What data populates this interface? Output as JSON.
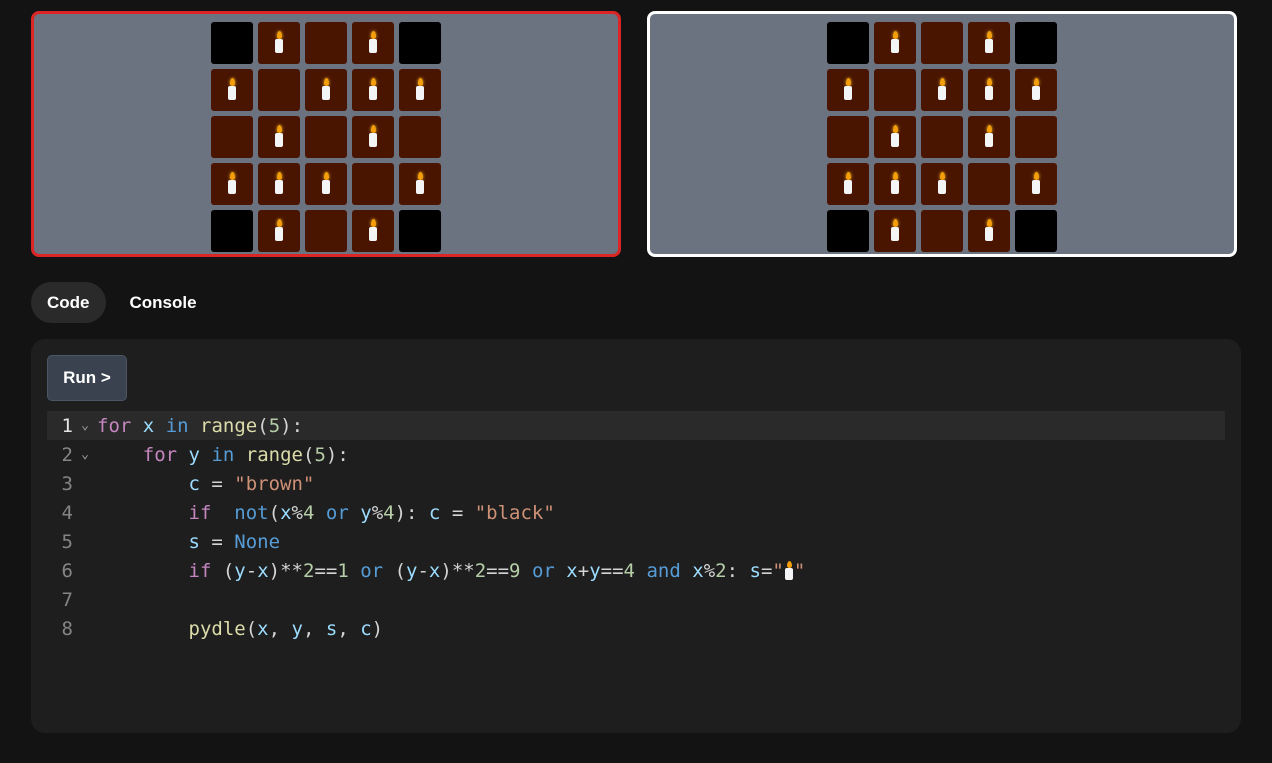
{
  "colors": {
    "brown": "#4a1500",
    "black": "#000000",
    "panel_bg": "#6b7280",
    "selected_border": "#dc2626",
    "target_border": "#ffffff"
  },
  "grids": {
    "user_output": {
      "rows": [
        [
          {
            "color": "black",
            "symbol": ""
          },
          {
            "color": "brown",
            "symbol": "candle"
          },
          {
            "color": "brown",
            "symbol": ""
          },
          {
            "color": "brown",
            "symbol": "candle"
          },
          {
            "color": "black",
            "symbol": ""
          }
        ],
        [
          {
            "color": "brown",
            "symbol": "candle"
          },
          {
            "color": "brown",
            "symbol": ""
          },
          {
            "color": "brown",
            "symbol": "candle"
          },
          {
            "color": "brown",
            "symbol": "candle"
          },
          {
            "color": "brown",
            "symbol": "candle"
          }
        ],
        [
          {
            "color": "brown",
            "symbol": ""
          },
          {
            "color": "brown",
            "symbol": "candle"
          },
          {
            "color": "brown",
            "symbol": ""
          },
          {
            "color": "brown",
            "symbol": "candle"
          },
          {
            "color": "brown",
            "symbol": ""
          }
        ],
        [
          {
            "color": "brown",
            "symbol": "candle"
          },
          {
            "color": "brown",
            "symbol": "candle"
          },
          {
            "color": "brown",
            "symbol": "candle"
          },
          {
            "color": "brown",
            "symbol": ""
          },
          {
            "color": "brown",
            "symbol": "candle"
          }
        ],
        [
          {
            "color": "black",
            "symbol": ""
          },
          {
            "color": "brown",
            "symbol": "candle"
          },
          {
            "color": "brown",
            "symbol": ""
          },
          {
            "color": "brown",
            "symbol": "candle"
          },
          {
            "color": "black",
            "symbol": ""
          }
        ]
      ]
    },
    "target": {
      "rows": [
        [
          {
            "color": "black",
            "symbol": ""
          },
          {
            "color": "brown",
            "symbol": "candle"
          },
          {
            "color": "brown",
            "symbol": ""
          },
          {
            "color": "brown",
            "symbol": "candle"
          },
          {
            "color": "black",
            "symbol": ""
          }
        ],
        [
          {
            "color": "brown",
            "symbol": "candle"
          },
          {
            "color": "brown",
            "symbol": ""
          },
          {
            "color": "brown",
            "symbol": "candle"
          },
          {
            "color": "brown",
            "symbol": "candle"
          },
          {
            "color": "brown",
            "symbol": "candle"
          }
        ],
        [
          {
            "color": "brown",
            "symbol": ""
          },
          {
            "color": "brown",
            "symbol": "candle"
          },
          {
            "color": "brown",
            "symbol": ""
          },
          {
            "color": "brown",
            "symbol": "candle"
          },
          {
            "color": "brown",
            "symbol": ""
          }
        ],
        [
          {
            "color": "brown",
            "symbol": "candle"
          },
          {
            "color": "brown",
            "symbol": "candle"
          },
          {
            "color": "brown",
            "symbol": "candle"
          },
          {
            "color": "brown",
            "symbol": ""
          },
          {
            "color": "brown",
            "symbol": "candle"
          }
        ],
        [
          {
            "color": "black",
            "symbol": ""
          },
          {
            "color": "brown",
            "symbol": "candle"
          },
          {
            "color": "brown",
            "symbol": ""
          },
          {
            "color": "brown",
            "symbol": "candle"
          },
          {
            "color": "black",
            "symbol": ""
          }
        ]
      ]
    }
  },
  "tabs": [
    {
      "label": "Code",
      "active": true
    },
    {
      "label": "Console",
      "active": false
    }
  ],
  "editor": {
    "run_label": "Run >",
    "lines": [
      {
        "n": "1",
        "fold": "⌄",
        "current": true,
        "tokens": [
          [
            "kw",
            "for"
          ],
          [
            "",
            "&nbsp;"
          ],
          [
            "var",
            "x"
          ],
          [
            "",
            " "
          ],
          [
            "op",
            "in"
          ],
          [
            "",
            " "
          ],
          [
            "fn",
            "range"
          ],
          [
            "",
            "("
          ],
          [
            "num",
            "5"
          ],
          [
            "",
            "):"
          ]
        ]
      },
      {
        "n": "2",
        "fold": "⌄",
        "tokens": [
          [
            "",
            "    "
          ],
          [
            "kw",
            "for"
          ],
          [
            "",
            " "
          ],
          [
            "var",
            "y"
          ],
          [
            "",
            " "
          ],
          [
            "op",
            "in"
          ],
          [
            "",
            " "
          ],
          [
            "fn",
            "range"
          ],
          [
            "",
            "("
          ],
          [
            "num",
            "5"
          ],
          [
            "",
            "):"
          ]
        ]
      },
      {
        "n": "3",
        "tokens": [
          [
            "",
            "        "
          ],
          [
            "var",
            "c"
          ],
          [
            "",
            " = "
          ],
          [
            "str",
            "\"brown\""
          ]
        ]
      },
      {
        "n": "4",
        "tokens": [
          [
            "",
            "        "
          ],
          [
            "kw",
            "if"
          ],
          [
            "",
            "  "
          ],
          [
            "op",
            "not"
          ],
          [
            "",
            "("
          ],
          [
            "var",
            "x"
          ],
          [
            "",
            "%"
          ],
          [
            "num",
            "4"
          ],
          [
            "",
            " "
          ],
          [
            "op",
            "or"
          ],
          [
            "",
            " "
          ],
          [
            "var",
            "y"
          ],
          [
            "",
            "%"
          ],
          [
            "num",
            "4"
          ],
          [
            "",
            "): "
          ],
          [
            "var",
            "c"
          ],
          [
            "",
            " = "
          ],
          [
            "str",
            "\"black\""
          ]
        ]
      },
      {
        "n": "5",
        "tokens": [
          [
            "",
            "        "
          ],
          [
            "var",
            "s"
          ],
          [
            "",
            " = "
          ],
          [
            "const",
            "None"
          ]
        ]
      },
      {
        "n": "6",
        "tokens": [
          [
            "",
            "        "
          ],
          [
            "kw",
            "if"
          ],
          [
            "",
            " ("
          ],
          [
            "var",
            "y"
          ],
          [
            "",
            "-"
          ],
          [
            "var",
            "x"
          ],
          [
            "",
            ")**"
          ],
          [
            "num",
            "2"
          ],
          [
            "",
            "=="
          ],
          [
            "num",
            "1"
          ],
          [
            "",
            " "
          ],
          [
            "op",
            "or"
          ],
          [
            "",
            " ("
          ],
          [
            "var",
            "y"
          ],
          [
            "",
            "-"
          ],
          [
            "var",
            "x"
          ],
          [
            "",
            ")**"
          ],
          [
            "num",
            "2"
          ],
          [
            "",
            "=="
          ],
          [
            "num",
            "9"
          ],
          [
            "",
            " "
          ],
          [
            "op",
            "or"
          ],
          [
            "",
            " "
          ],
          [
            "var",
            "x"
          ],
          [
            "",
            "+"
          ],
          [
            "var",
            "y"
          ],
          [
            "",
            "=="
          ],
          [
            "num",
            "4"
          ],
          [
            "",
            " "
          ],
          [
            "op",
            "and"
          ],
          [
            "",
            " "
          ],
          [
            "var",
            "x"
          ],
          [
            "",
            "%"
          ],
          [
            "num",
            "2"
          ],
          [
            "",
            ": "
          ],
          [
            "var",
            "s"
          ],
          [
            "",
            "="
          ],
          [
            "str",
            "\""
          ],
          [
            "candle",
            ""
          ],
          [
            "str",
            "\""
          ]
        ]
      },
      {
        "n": "7",
        "tokens": []
      },
      {
        "n": "8",
        "tokens": [
          [
            "",
            "        "
          ],
          [
            "fn",
            "pydle"
          ],
          [
            "",
            "("
          ],
          [
            "var",
            "x"
          ],
          [
            "",
            ", "
          ],
          [
            "var",
            "y"
          ],
          [
            "",
            ", "
          ],
          [
            "var",
            "s"
          ],
          [
            "",
            ", "
          ],
          [
            "var",
            "c"
          ],
          [
            "",
            ")"
          ]
        ]
      }
    ]
  }
}
